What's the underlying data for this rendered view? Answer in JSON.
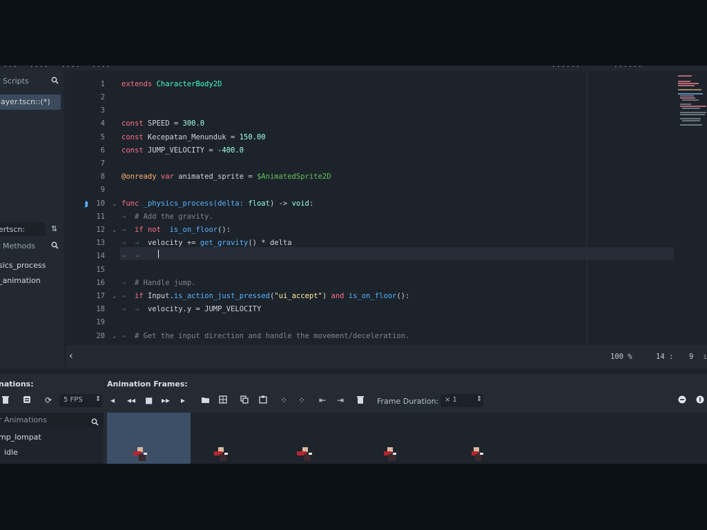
{
  "menubar": {
    "items": [
      "...",
      "...",
      "...",
      "..."
    ],
    "right_items": [
      "...",
      "..."
    ]
  },
  "scripts_panel": {
    "filter_placeholder": "r Scripts",
    "items": [
      "layer.tscn::(*)"
    ]
  },
  "methods_panel": {
    "file_label": "ertscn:",
    "filter_placeholder": "r Methods",
    "items": [
      "sics_process",
      "_animation"
    ]
  },
  "editor": {
    "line_numbers": [
      "1",
      "2",
      "3",
      "4",
      "5",
      "6",
      "7",
      "8",
      "9",
      "10",
      "11",
      "12",
      "13",
      "14",
      "15",
      "16",
      "17",
      "18",
      "19",
      "20"
    ],
    "lines": {
      "l1": [
        "extends",
        " CharacterBody2D"
      ],
      "l4": [
        "const",
        " SPEED = ",
        "300.0"
      ],
      "l5": [
        "const",
        " Kecepatan_Menunduk = ",
        "150.00"
      ],
      "l6": [
        "const",
        " JUMP_VELOCITY = ",
        "-400.0"
      ],
      "l8": [
        "@onready",
        " var",
        " animated_sprite = ",
        "$AnimatedSprite2D"
      ],
      "l10": [
        "func",
        " _physics_process(delta: ",
        "float",
        ") -> ",
        "void",
        ":"
      ],
      "l11": "# Add the gravity.",
      "l12": [
        "if",
        " not",
        " is_on_floor",
        "():"
      ],
      "l13": [
        "velocity += ",
        "get_gravity",
        "() * delta"
      ],
      "l16": "# Handle jump.",
      "l17": [
        "if",
        " Input.",
        "is_action_just_pressed",
        "(",
        "\"ui_accept\"",
        ") ",
        "and",
        " ",
        "is_on_floor",
        "():"
      ],
      "l18": "velocity.y = JUMP_VELOCITY",
      "l20": "# Get the input direction and handle the movement/deceleration."
    }
  },
  "statusbar": {
    "zoom": "100 %",
    "line": "14 :",
    "col": "9"
  },
  "bottom_panel": {
    "animations_title": "nations:",
    "frames_title": "Animation Frames:",
    "fps_value": "5 FPS",
    "frame_duration_label": "Frame Duration:",
    "frame_duration_value": "× 1",
    "animations_filter_placeholder": "r Animations",
    "animations": [
      "mp_lompat",
      "idle"
    ]
  },
  "colors": {
    "background": "#1e242c",
    "keyword": "#ff7085",
    "type": "#8fffda",
    "function": "#57b3ff",
    "string": "#ffeda1",
    "comment": "#7f868e",
    "selection": "#3c4f66"
  }
}
